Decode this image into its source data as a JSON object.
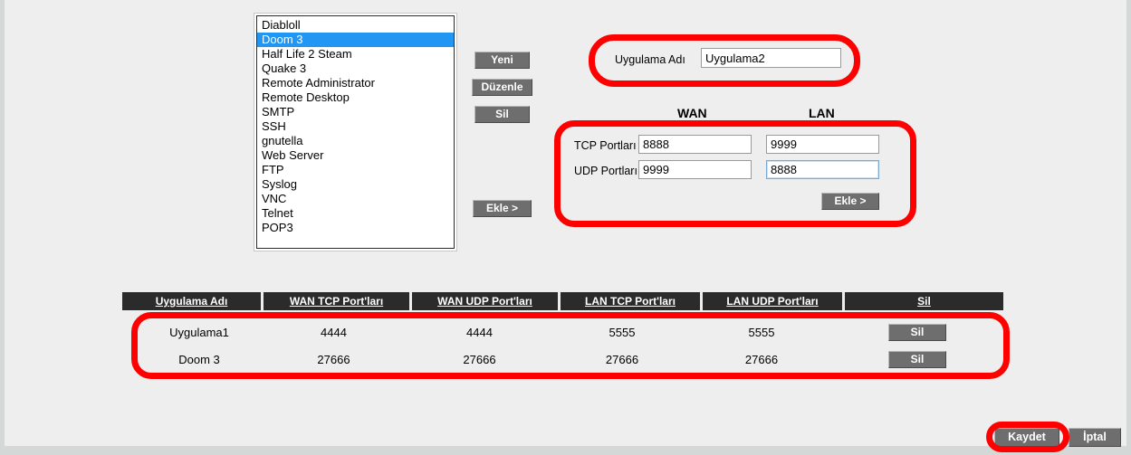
{
  "app_list": {
    "items": [
      {
        "label": "Diabloll",
        "selected": false
      },
      {
        "label": "Doom 3",
        "selected": true
      },
      {
        "label": "Half Life 2 Steam",
        "selected": false
      },
      {
        "label": "Quake 3",
        "selected": false
      },
      {
        "label": "Remote Administrator",
        "selected": false
      },
      {
        "label": "Remote Desktop",
        "selected": false
      },
      {
        "label": "SMTP",
        "selected": false
      },
      {
        "label": "SSH",
        "selected": false
      },
      {
        "label": "gnutella",
        "selected": false
      },
      {
        "label": "Web Server",
        "selected": false
      },
      {
        "label": "FTP",
        "selected": false
      },
      {
        "label": "Syslog",
        "selected": false
      },
      {
        "label": "VNC",
        "selected": false
      },
      {
        "label": "Telnet",
        "selected": false
      },
      {
        "label": "POP3",
        "selected": false
      }
    ]
  },
  "side_buttons": {
    "new": "Yeni",
    "edit": "Düzenle",
    "delete": "Sil",
    "add": "Ekle >"
  },
  "name_panel": {
    "label": "Uygulama Adı",
    "value": "Uygulama2",
    "placeholder": ""
  },
  "ports_panel": {
    "wan_header": "WAN",
    "lan_header": "LAN",
    "tcp_label": "TCP Portları",
    "udp_label": "UDP Portları",
    "wan_tcp": "8888",
    "lan_tcp": "9999",
    "wan_udp": "9999",
    "lan_udp": "8888",
    "add_button": "Ekle >"
  },
  "table": {
    "headers": [
      "Uygulama Adı",
      "WAN TCP Port'ları",
      "WAN UDP Port'ları",
      "LAN TCP Port'ları",
      "LAN UDP Port'ları",
      "Sil"
    ],
    "rows": [
      {
        "name": "Uygulama1",
        "wan_tcp": "4444",
        "wan_udp": "4444",
        "lan_tcp": "5555",
        "lan_udp": "5555",
        "delete_label": "Sil"
      },
      {
        "name": "Doom 3",
        "wan_tcp": "27666",
        "wan_udp": "27666",
        "lan_tcp": "27666",
        "lan_udp": "27666",
        "delete_label": "Sil"
      }
    ]
  },
  "footer": {
    "save": "Kaydet",
    "cancel": "İptal"
  },
  "annotations": {
    "color": "#ff0000",
    "count": 4
  },
  "colors": {
    "background": "#eeeeee",
    "edge": "#d4d9d8",
    "button_face": "#6e6e6e",
    "selection_blue": "#2196f3",
    "table_header": "#2b2b2b",
    "annotation_red": "#ff0000"
  }
}
